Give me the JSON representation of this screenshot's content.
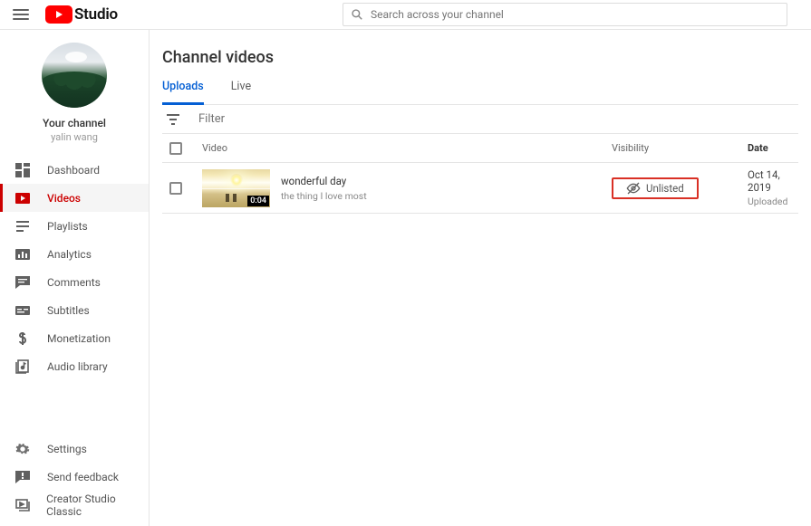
{
  "header": {
    "product_name": "Studio",
    "search_placeholder": "Search across your channel"
  },
  "sidebar": {
    "section_label": "Your channel",
    "channel_name": "yalin wang",
    "items": [
      {
        "label": "Dashboard",
        "icon": "dashboard-icon"
      },
      {
        "label": "Videos",
        "icon": "videos-icon",
        "active": true
      },
      {
        "label": "Playlists",
        "icon": "playlists-icon"
      },
      {
        "label": "Analytics",
        "icon": "analytics-icon"
      },
      {
        "label": "Comments",
        "icon": "comments-icon"
      },
      {
        "label": "Subtitles",
        "icon": "subtitles-icon"
      },
      {
        "label": "Monetization",
        "icon": "monetization-icon"
      },
      {
        "label": "Audio library",
        "icon": "audio-library-icon"
      }
    ],
    "footer": [
      {
        "label": "Settings",
        "icon": "settings-icon"
      },
      {
        "label": "Send feedback",
        "icon": "feedback-icon"
      },
      {
        "label": "Creator Studio Classic",
        "icon": "classic-icon"
      }
    ]
  },
  "main": {
    "title": "Channel videos",
    "tabs": [
      {
        "label": "Uploads",
        "active": true
      },
      {
        "label": "Live"
      }
    ],
    "filter_placeholder": "Filter",
    "columns": {
      "video": "Video",
      "visibility": "Visibility",
      "date": "Date"
    },
    "rows": [
      {
        "title": "wonderful day",
        "description": "the thing I love most",
        "duration": "0:04",
        "visibility": "Unlisted",
        "visibility_highlighted": true,
        "date": "Oct 14, 2019",
        "date_status": "Uploaded"
      }
    ]
  }
}
